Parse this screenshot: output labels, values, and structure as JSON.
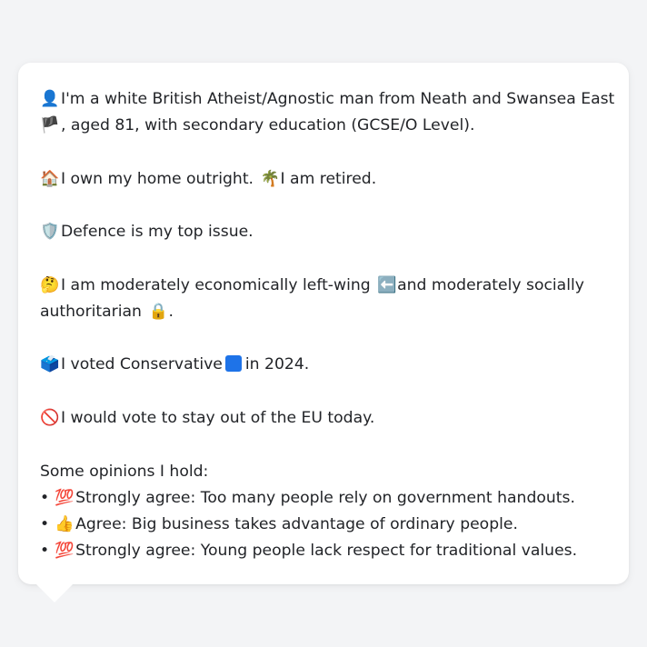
{
  "profile": {
    "line1a": "I'm a white British Atheist/Agnostic man from Neath and Swansea East",
    "line1b": ", aged 81, with secondary education (GCSE/O Level).",
    "home": "I own my home outright.",
    "retired": "I am retired.",
    "issue": "Defence is my top issue.",
    "econ_a": "I am moderately economically left-wing",
    "econ_b": "and moderately socially",
    "econ_c": "authoritarian",
    "econ_c_end": ".",
    "vote_a": "I voted Conservative",
    "vote_b": "in 2024.",
    "eu": "I would vote to stay out of the EU today.",
    "opinions_heading": "Some opinions I hold:",
    "opinions": [
      {
        "emoji": "💯",
        "text": "Strongly agree: Too many people rely on government handouts."
      },
      {
        "emoji": "👍",
        "text": "Agree: Big business takes advantage of ordinary people."
      },
      {
        "emoji": "💯",
        "text": "Strongly agree: Young people lack respect for traditional values."
      }
    ]
  },
  "icons": {
    "person": "👤",
    "wales_flag": "🏴",
    "house": "🏠",
    "palm": "🌴",
    "shield": "🛡️",
    "thinking": "🤔",
    "left_arrow": "⬅️",
    "lock": "🔒",
    "ballot": "🗳️",
    "no_entry": "🚫",
    "bullet": "•"
  },
  "colors": {
    "conservative_square": "#1e73e8",
    "left_arrow_bg": "#6b7f99"
  }
}
